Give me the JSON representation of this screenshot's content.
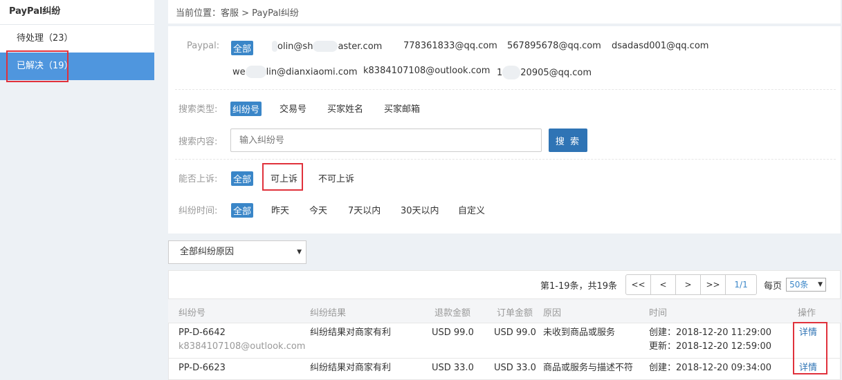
{
  "sidebar": {
    "title": "PayPal纠纷",
    "items": [
      {
        "label": "待处理（23）",
        "active": false
      },
      {
        "label": "已解决（19）",
        "active": true
      }
    ]
  },
  "breadcrumb": "当前位置：客服 > PayPal纠纷",
  "paypal": {
    "label": "Paypal:",
    "all": "全部",
    "accounts": [
      "olin@sh",
      "aster.com",
      "778361833@qq.com",
      "567895678@qq.com",
      "dsadasd001@qq.com",
      "we",
      "lin@dianxiaomi.com",
      "k8384107108@outlook.com",
      "1",
      "20905@qq.com"
    ]
  },
  "search_type": {
    "label": "搜索类型:",
    "options": [
      "纠纷号",
      "交易号",
      "买家姓名",
      "买家邮箱"
    ]
  },
  "search": {
    "label": "搜索内容:",
    "placeholder": "输入纠纷号",
    "button": "搜 索"
  },
  "appeal": {
    "label": "能否上诉:",
    "options": [
      "全部",
      "可上诉",
      "不可上诉"
    ]
  },
  "time": {
    "label": "纠纷时间:",
    "options": [
      "全部",
      "昨天",
      "今天",
      "7天以内",
      "30天以内",
      "自定义"
    ]
  },
  "reason_select": {
    "value": "全部纠纷原因",
    "caret": "▼"
  },
  "pagination": {
    "summary": "第1-19条，共19条",
    "first": "<<",
    "prev": "<",
    "next": ">",
    "last": ">>",
    "current": "1/1",
    "per_page_label": "每页",
    "per_page_value": "50条",
    "caret": "▼"
  },
  "table": {
    "headers": [
      "纠纷号",
      "纠纷结果",
      "退款金额",
      "订单金额",
      "原因",
      "时间",
      "操作"
    ],
    "rows": [
      {
        "id": "PP-D-6642",
        "email": "k8384107108@outlook.com",
        "result": "纠纷结果对商家有利",
        "refund": "USD 99.0",
        "order": "USD 99.0",
        "reason": "未收到商品或服务",
        "created": "创建：2018-12-20 11:29:00",
        "updated": "更新：2018-12-20 12:59:00",
        "action": "详情"
      },
      {
        "id": "PP-D-6623",
        "email": "",
        "result": "纠纷结果对商家有利",
        "refund": "USD 33.0",
        "order": "USD 33.0",
        "reason": "商品或服务与描述不符",
        "created": "创建：2018-12-20 09:34:00",
        "updated": "",
        "action": "详情"
      }
    ]
  },
  "colors": {
    "accent": "#4f96de",
    "selected": "#3a86c8",
    "button": "#2f74b5",
    "highlight": "#e0313b"
  }
}
